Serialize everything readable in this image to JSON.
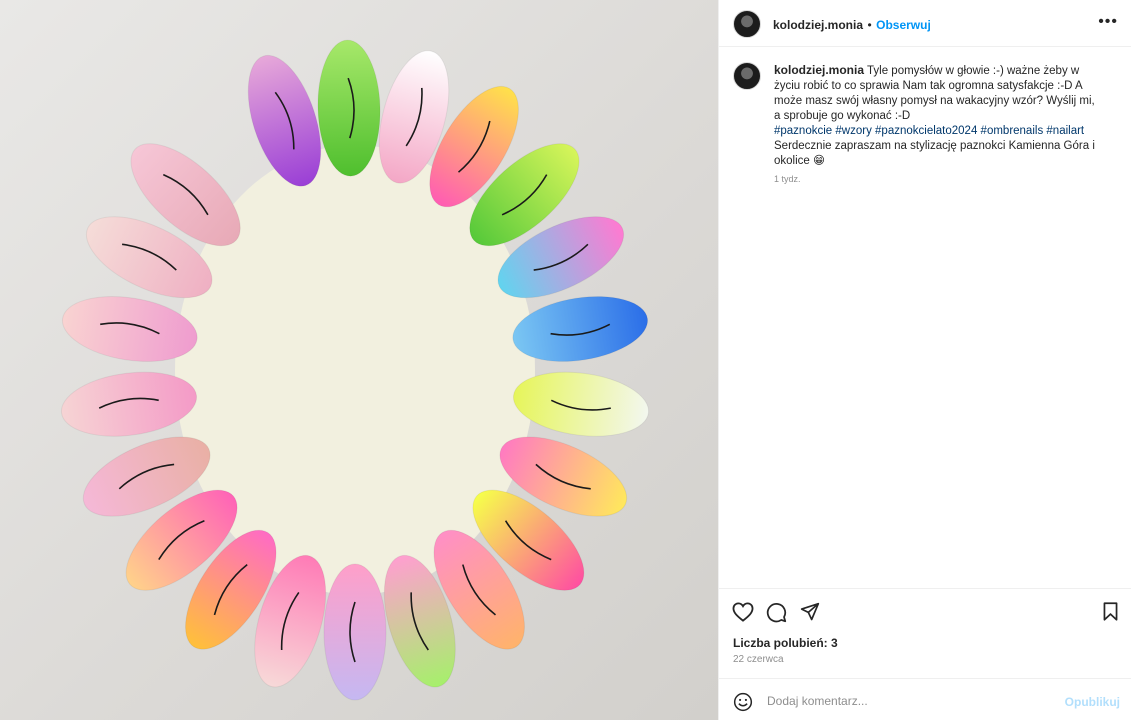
{
  "post": {
    "image_alt": "",
    "nail_colors": [
      [
        "#e7a8d9",
        "#9a3fd6"
      ],
      [
        "#a7e86a",
        "#4fbf2e"
      ],
      [
        "#ffffff",
        "#f4a7c6"
      ],
      [
        "#ffe14a",
        "#ff5cb3"
      ],
      [
        "#d7f55a",
        "#56c93a"
      ],
      [
        "#ff7ad1",
        "#61d4ef"
      ],
      [
        "#2b6ee8",
        "#7bc7f3"
      ],
      [
        "#f3f7ef",
        "#e6f55a"
      ],
      [
        "#ffe85c",
        "#ff7ac1"
      ],
      [
        "#ff4fa1",
        "#f6ff4a"
      ],
      [
        "#ffb36b",
        "#ff8fc6"
      ],
      [
        "#a6f06b",
        "#ff9fd0"
      ],
      [
        "#c5b8f2",
        "#ff9fc9"
      ],
      [
        "#f7d9d8",
        "#ff7bb6"
      ],
      [
        "#ffc03a",
        "#ff6bc4"
      ],
      [
        "#ffd28a",
        "#ff63b7"
      ],
      [
        "#f5b8d7",
        "#e9b0a5"
      ],
      [
        "#f6d4d4",
        "#f49ac7"
      ],
      [
        "#f9d3d1",
        "#ef9ccf"
      ],
      [
        "#f5dcd8",
        "#efb0c3"
      ],
      [
        "#f6c6d6",
        "#e8aab7"
      ]
    ]
  },
  "header": {
    "username": "kolodziej.monia",
    "separator": "•",
    "follow_label": "Obserwuj",
    "more_label": "•••"
  },
  "caption": {
    "username": "kolodziej.monia",
    "text": "Tyle pomysłów w głowie :-) ważne żeby w życiu robić to co sprawia Nam tak ogromna satysfakcje :-D A może masz swój własny pomysł na wakacyjny wzór? Wyślij mi, a sprobuje go wykonać :-D",
    "hashtags": [
      "#paznokcie",
      "#wzory",
      "#paznokcielato2024",
      "#ombrenails",
      "#nailart"
    ],
    "text2": "Serdecznie zapraszam na stylizację paznokci Kamienna Góra i okolice 😁",
    "time": "1 tydz."
  },
  "actions": {
    "likes": "Liczba polubień: 3",
    "date": "22 czerwca"
  },
  "comment": {
    "placeholder": "Dodaj komentarz...",
    "publish_label": "Opublikuj"
  }
}
